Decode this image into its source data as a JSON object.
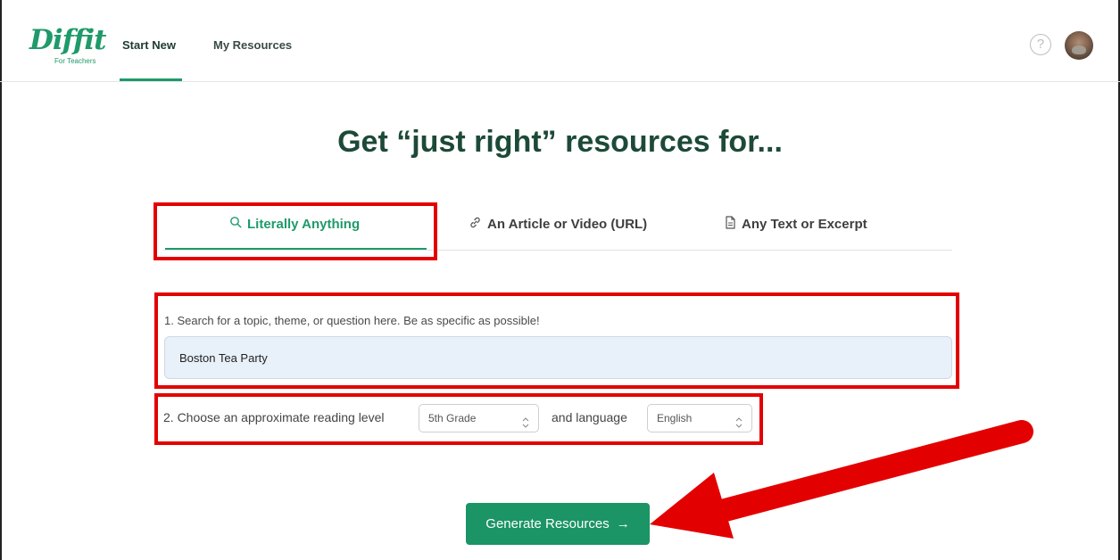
{
  "header": {
    "logo_text": "Diffit",
    "logo_subtext": "For Teachers",
    "nav": [
      {
        "label": "Start New",
        "active": true
      },
      {
        "label": "My Resources",
        "active": false
      }
    ],
    "help_icon": "help-circle-icon",
    "avatar_icon": "user-avatar"
  },
  "main": {
    "title": "Get “just right” resources for...",
    "tabs": [
      {
        "label": "Literally Anything",
        "icon": "search-icon",
        "active": true
      },
      {
        "label": "An Article or Video (URL)",
        "icon": "link-icon",
        "active": false
      },
      {
        "label": "Any Text or Excerpt",
        "icon": "document-icon",
        "active": false
      }
    ],
    "search": {
      "label": "1. Search for a topic, theme, or question here. Be as specific as possible!",
      "value": "Boston Tea Party"
    },
    "reading_level": {
      "label": "2. Choose an approximate reading level",
      "grade_value": "5th Grade",
      "and_language_label": "and language",
      "language_value": "English"
    },
    "generate_button": {
      "label": "Generate Resources",
      "arrow": "→"
    }
  },
  "colors": {
    "brand_green": "#1f9a6a",
    "title_green": "#1d4a38",
    "annotation_red": "#e30000",
    "input_bg": "#e8f0fa"
  }
}
